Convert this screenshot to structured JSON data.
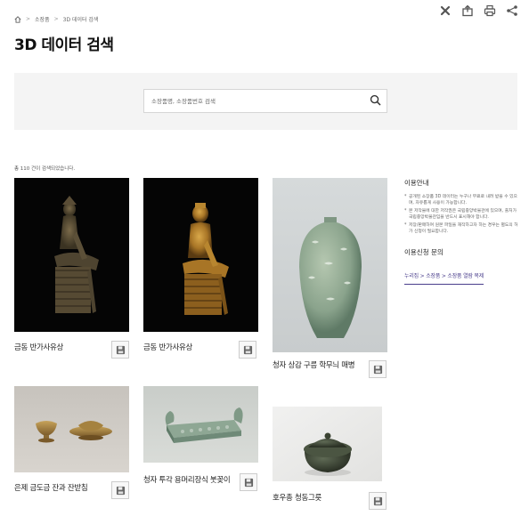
{
  "breadcrumb": {
    "home_icon": "home-icon",
    "items": [
      "소장품",
      "3D 데이터 검색"
    ],
    "separator": ">"
  },
  "toolbar": {
    "icons": [
      "close-cross-icon",
      "share-export-icon",
      "print-icon",
      "share-icon"
    ]
  },
  "page": {
    "title": "3D 데이터 검색"
  },
  "search": {
    "placeholder": "소장품명, 소장품번호 검색",
    "value": ""
  },
  "results": {
    "count_text": "총 110 건이 검색되었습니다.",
    "items": [
      {
        "title": "금동 반가사유상"
      },
      {
        "title": "금동 반가사유상"
      },
      {
        "title": "청자 상감 구름 학무늬 매병"
      },
      {
        "title": "은제 금도금 잔과 잔받침"
      },
      {
        "title": "청자 투각 용머리장식 붓꽂이"
      },
      {
        "title": "호우총 청동그릇"
      }
    ]
  },
  "info": {
    "heading": "이용안내",
    "notes": [
      "공개된 소장품 3D 데이터는 누구나 무료로 내려 받을 수 있으며, 자유롭게 사용이 가능합니다.",
      "본 저작물에 대한 저작권은 국립중앙박물관에 있으며, 출처가 국립중앙박물관임을 반드시 표시해야 합니다.",
      "저장/판매하여 원본 파일을 재작하고자 하는 경우는 별도의 허가 신청이 필요합니다."
    ],
    "contact_heading": "이용신청 문의",
    "contact_link": "누리집 > 소장품 > 소장품 열람 복제"
  },
  "colors": {
    "search_bg": "#f4f4f4",
    "link": "#4a3e8c"
  }
}
